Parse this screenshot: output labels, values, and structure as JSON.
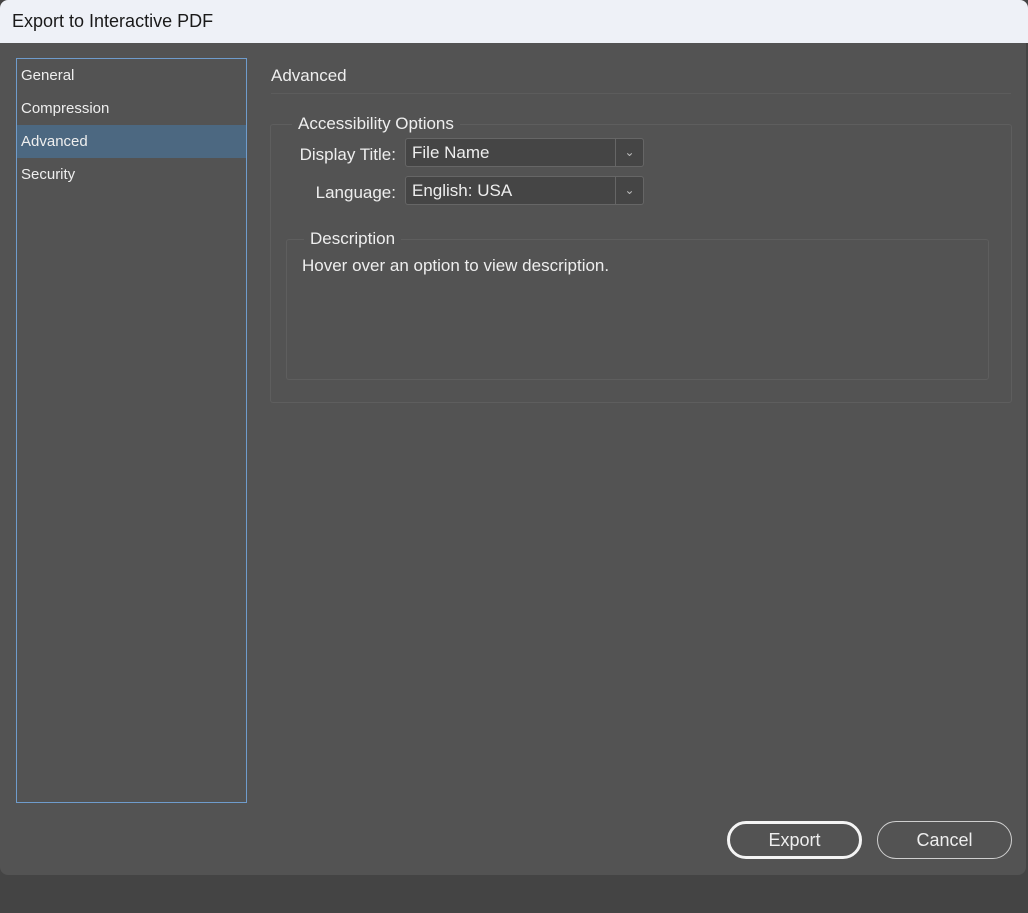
{
  "window": {
    "title": "Export to Interactive PDF"
  },
  "sidebar": {
    "items": [
      {
        "label": "General"
      },
      {
        "label": "Compression"
      },
      {
        "label": "Advanced",
        "selected": true
      },
      {
        "label": "Security"
      }
    ]
  },
  "main": {
    "heading": "Advanced",
    "accessibility": {
      "legend": "Accessibility Options",
      "display_title": {
        "label": "Display Title:",
        "value": "File Name"
      },
      "language": {
        "label": "Language:",
        "value": "English: USA"
      }
    },
    "description": {
      "legend": "Description",
      "text": "Hover over an option to view description."
    }
  },
  "buttons": {
    "export": "Export",
    "cancel": "Cancel"
  },
  "colors": {
    "selection": "#4c6881",
    "dialog_bg": "#535353",
    "focus_border": "#6f9ccc"
  }
}
